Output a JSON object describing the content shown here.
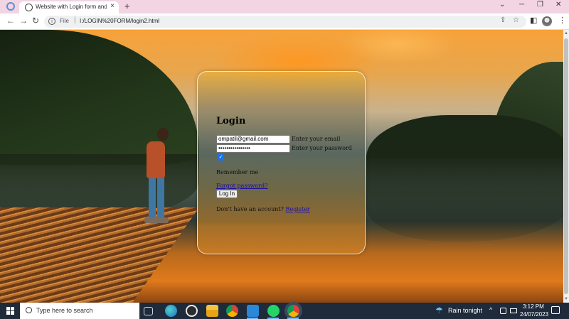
{
  "browser": {
    "tab_title": "Website with Login form and Re",
    "tab_close": "×",
    "new_tab": "+",
    "url_scheme": "File",
    "url_sep": "|",
    "url": "I:/LOGIN%20FORM/login2.html",
    "window_minimize": "─",
    "window_restore": "❐",
    "window_close": "✕",
    "tab_search": "⌄",
    "back": "←",
    "forward": "→",
    "reload": "↻",
    "info": "i",
    "share": "⇪",
    "bookmark": "☆",
    "side_panel": "◧",
    "menu": "⋮"
  },
  "login": {
    "title": "Login",
    "email_value": "ompatil@gmail.com",
    "email_label": "Enter your email",
    "password_value": "••••••••••••••••",
    "password_label": "Enter your password",
    "remember_checked": true,
    "remember_check_mark": "✓",
    "remember_label": "Remember me",
    "forgot_link": "Forgot password?",
    "login_button": "Log In",
    "no_account_text": "Don't have an account?",
    "register_link": "Register"
  },
  "scrollbar": {
    "up_arrow": "▲",
    "down_arrow": "▼"
  },
  "taskbar": {
    "search_placeholder": "Type here to search",
    "weather_icon": "☂",
    "weather_text": "Rain tonight",
    "tray_chevron": "^",
    "time": "3:12 PM",
    "date": "24/07/2023"
  },
  "colors": {
    "tab_strip": "#f3d4e3",
    "taskbar": "#1f2b3a",
    "link": "#1a0dab",
    "checkbox": "#1a73e8"
  }
}
